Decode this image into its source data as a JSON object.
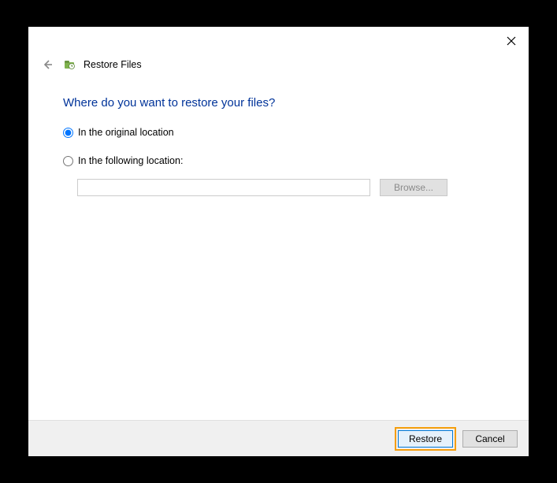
{
  "header": {
    "title": "Restore Files"
  },
  "content": {
    "heading": "Where do you want to restore your files?",
    "radio_original": "In the original location",
    "radio_following": "In the following location:",
    "location_value": "",
    "browse_label": "Browse...",
    "selected_option": "original"
  },
  "footer": {
    "restore_label": "Restore",
    "cancel_label": "Cancel"
  }
}
